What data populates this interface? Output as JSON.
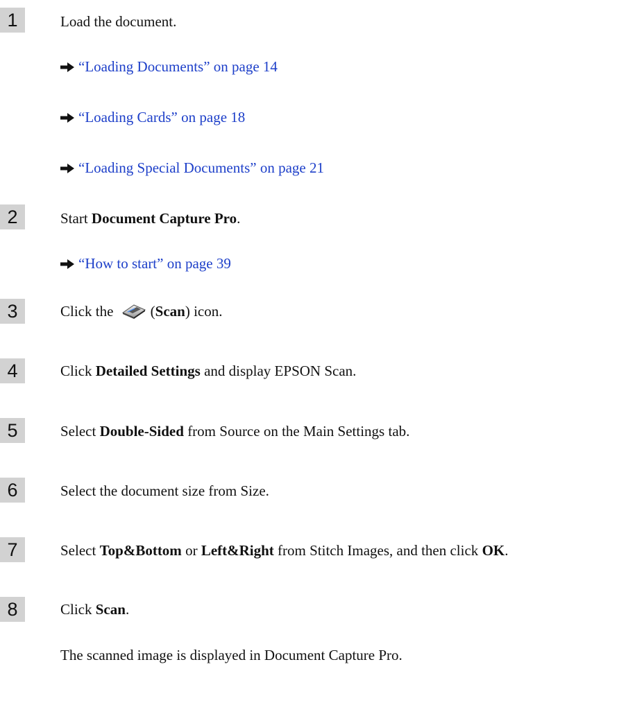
{
  "steps": [
    {
      "number": "1",
      "text": "Load the document.",
      "links": [
        "“Loading Documents” on page 14",
        "“Loading Cards” on page 18",
        "“Loading Special Documents” on page 21"
      ]
    },
    {
      "number": "2",
      "pre": "Start ",
      "bold": "Document Capture Pro",
      "post": ".",
      "links": [
        "“How to start” on page 39"
      ]
    },
    {
      "number": "3",
      "pre": "Click the",
      "open_paren": "(",
      "bold": "Scan",
      "post": ") icon.",
      "icon": "scan-icon"
    },
    {
      "number": "4",
      "pre": "Click ",
      "bold": "Detailed Settings",
      "post": " and display EPSON Scan."
    },
    {
      "number": "5",
      "pre": "Select ",
      "bold": "Double-Sided",
      "post": " from Source on the Main Settings tab."
    },
    {
      "number": "6",
      "text": "Select the document size from Size."
    },
    {
      "number": "7",
      "pre": "Select ",
      "bold1": "Top&Bottom",
      "mid1": " or ",
      "bold2": "Left&Right",
      "mid2": " from Stitch Images, and then click ",
      "bold3": "OK",
      "post": "."
    },
    {
      "number": "8",
      "pre": "Click ",
      "bold": "Scan",
      "post": ".",
      "result": "The scanned image is displayed in Document Capture Pro."
    }
  ],
  "colors": {
    "link": "#1d3fc9",
    "badge": "#d2d2d2"
  }
}
